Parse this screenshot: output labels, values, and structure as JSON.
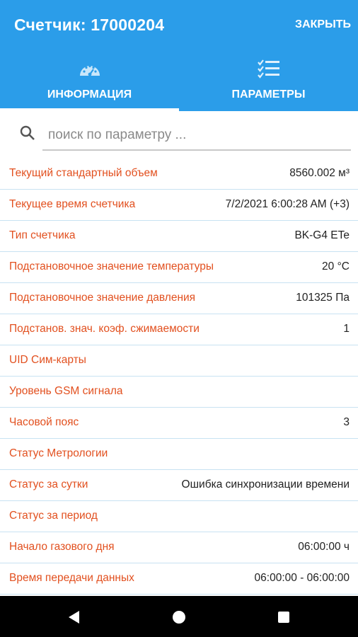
{
  "header": {
    "title": "Счетчик: 17000204",
    "close_label": "ЗАКРЫТЬ"
  },
  "tabs": [
    {
      "label": "ИНФОРМАЦИЯ",
      "icon": "speedometer-icon",
      "active": true
    },
    {
      "label": "ПАРАМЕТРЫ",
      "icon": "checklist-icon",
      "active": false
    }
  ],
  "search": {
    "placeholder": "поиск по параметру ...",
    "value": ""
  },
  "rows": [
    {
      "label": "Текущий стандартный объем",
      "value": "8560.002 м³"
    },
    {
      "label": "Текущее время счетчика",
      "value": "7/2/2021 6:00:28 AM (+3)"
    },
    {
      "label": "Тип счетчика",
      "value": "BK-G4 ETe"
    },
    {
      "label": "Подстановочное значение температуры",
      "value": "20 °C"
    },
    {
      "label": "Подстановочное значение давления",
      "value": "101325 Па"
    },
    {
      "label": "Подстанов. знач. коэф. сжимаемости",
      "value": "1"
    },
    {
      "label": "UID Сим-карты",
      "value": ""
    },
    {
      "label": "Уровень GSM сигнала",
      "value": ""
    },
    {
      "label": "Часовой пояс",
      "value": "3"
    },
    {
      "label": "Статус Метрологии",
      "value": ""
    },
    {
      "label": "Статус за сутки",
      "value": "Ошибка синхронизации времени"
    },
    {
      "label": "Статус за период",
      "value": ""
    },
    {
      "label": "Начало газового дня",
      "value": "06:00:00 ч"
    },
    {
      "label": "Время передачи данных",
      "value": "06:00:00 - 06:00:00"
    }
  ],
  "colors": {
    "appbar": "#2b9de9",
    "label": "#e2501f",
    "divider": "#c8e2f2"
  }
}
